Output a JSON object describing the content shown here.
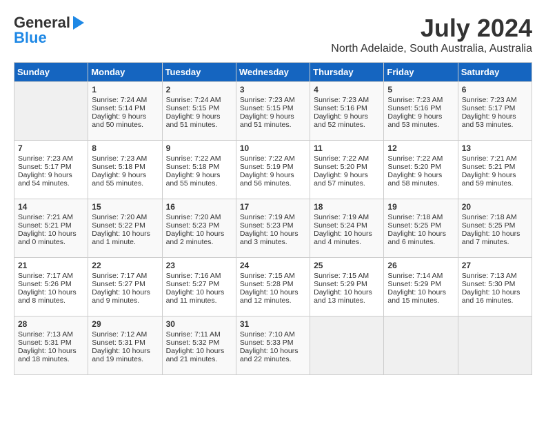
{
  "logo": {
    "general": "General",
    "blue": "Blue"
  },
  "header": {
    "month_year": "July 2024",
    "location": "North Adelaide, South Australia, Australia"
  },
  "weekdays": [
    "Sunday",
    "Monday",
    "Tuesday",
    "Wednesday",
    "Thursday",
    "Friday",
    "Saturday"
  ],
  "weeks": [
    [
      {
        "day": "",
        "info": ""
      },
      {
        "day": "1",
        "info": "Sunrise: 7:24 AM\nSunset: 5:14 PM\nDaylight: 9 hours\nand 50 minutes."
      },
      {
        "day": "2",
        "info": "Sunrise: 7:24 AM\nSunset: 5:15 PM\nDaylight: 9 hours\nand 51 minutes."
      },
      {
        "day": "3",
        "info": "Sunrise: 7:23 AM\nSunset: 5:15 PM\nDaylight: 9 hours\nand 51 minutes."
      },
      {
        "day": "4",
        "info": "Sunrise: 7:23 AM\nSunset: 5:16 PM\nDaylight: 9 hours\nand 52 minutes."
      },
      {
        "day": "5",
        "info": "Sunrise: 7:23 AM\nSunset: 5:16 PM\nDaylight: 9 hours\nand 53 minutes."
      },
      {
        "day": "6",
        "info": "Sunrise: 7:23 AM\nSunset: 5:17 PM\nDaylight: 9 hours\nand 53 minutes."
      }
    ],
    [
      {
        "day": "7",
        "info": "Sunrise: 7:23 AM\nSunset: 5:17 PM\nDaylight: 9 hours\nand 54 minutes."
      },
      {
        "day": "8",
        "info": "Sunrise: 7:23 AM\nSunset: 5:18 PM\nDaylight: 9 hours\nand 55 minutes."
      },
      {
        "day": "9",
        "info": "Sunrise: 7:22 AM\nSunset: 5:18 PM\nDaylight: 9 hours\nand 55 minutes."
      },
      {
        "day": "10",
        "info": "Sunrise: 7:22 AM\nSunset: 5:19 PM\nDaylight: 9 hours\nand 56 minutes."
      },
      {
        "day": "11",
        "info": "Sunrise: 7:22 AM\nSunset: 5:20 PM\nDaylight: 9 hours\nand 57 minutes."
      },
      {
        "day": "12",
        "info": "Sunrise: 7:22 AM\nSunset: 5:20 PM\nDaylight: 9 hours\nand 58 minutes."
      },
      {
        "day": "13",
        "info": "Sunrise: 7:21 AM\nSunset: 5:21 PM\nDaylight: 9 hours\nand 59 minutes."
      }
    ],
    [
      {
        "day": "14",
        "info": "Sunrise: 7:21 AM\nSunset: 5:21 PM\nDaylight: 10 hours\nand 0 minutes."
      },
      {
        "day": "15",
        "info": "Sunrise: 7:20 AM\nSunset: 5:22 PM\nDaylight: 10 hours\nand 1 minute."
      },
      {
        "day": "16",
        "info": "Sunrise: 7:20 AM\nSunset: 5:23 PM\nDaylight: 10 hours\nand 2 minutes."
      },
      {
        "day": "17",
        "info": "Sunrise: 7:19 AM\nSunset: 5:23 PM\nDaylight: 10 hours\nand 3 minutes."
      },
      {
        "day": "18",
        "info": "Sunrise: 7:19 AM\nSunset: 5:24 PM\nDaylight: 10 hours\nand 4 minutes."
      },
      {
        "day": "19",
        "info": "Sunrise: 7:18 AM\nSunset: 5:25 PM\nDaylight: 10 hours\nand 6 minutes."
      },
      {
        "day": "20",
        "info": "Sunrise: 7:18 AM\nSunset: 5:25 PM\nDaylight: 10 hours\nand 7 minutes."
      }
    ],
    [
      {
        "day": "21",
        "info": "Sunrise: 7:17 AM\nSunset: 5:26 PM\nDaylight: 10 hours\nand 8 minutes."
      },
      {
        "day": "22",
        "info": "Sunrise: 7:17 AM\nSunset: 5:27 PM\nDaylight: 10 hours\nand 9 minutes."
      },
      {
        "day": "23",
        "info": "Sunrise: 7:16 AM\nSunset: 5:27 PM\nDaylight: 10 hours\nand 11 minutes."
      },
      {
        "day": "24",
        "info": "Sunrise: 7:15 AM\nSunset: 5:28 PM\nDaylight: 10 hours\nand 12 minutes."
      },
      {
        "day": "25",
        "info": "Sunrise: 7:15 AM\nSunset: 5:29 PM\nDaylight: 10 hours\nand 13 minutes."
      },
      {
        "day": "26",
        "info": "Sunrise: 7:14 AM\nSunset: 5:29 PM\nDaylight: 10 hours\nand 15 minutes."
      },
      {
        "day": "27",
        "info": "Sunrise: 7:13 AM\nSunset: 5:30 PM\nDaylight: 10 hours\nand 16 minutes."
      }
    ],
    [
      {
        "day": "28",
        "info": "Sunrise: 7:13 AM\nSunset: 5:31 PM\nDaylight: 10 hours\nand 18 minutes."
      },
      {
        "day": "29",
        "info": "Sunrise: 7:12 AM\nSunset: 5:31 PM\nDaylight: 10 hours\nand 19 minutes."
      },
      {
        "day": "30",
        "info": "Sunrise: 7:11 AM\nSunset: 5:32 PM\nDaylight: 10 hours\nand 21 minutes."
      },
      {
        "day": "31",
        "info": "Sunrise: 7:10 AM\nSunset: 5:33 PM\nDaylight: 10 hours\nand 22 minutes."
      },
      {
        "day": "",
        "info": ""
      },
      {
        "day": "",
        "info": ""
      },
      {
        "day": "",
        "info": ""
      }
    ]
  ]
}
